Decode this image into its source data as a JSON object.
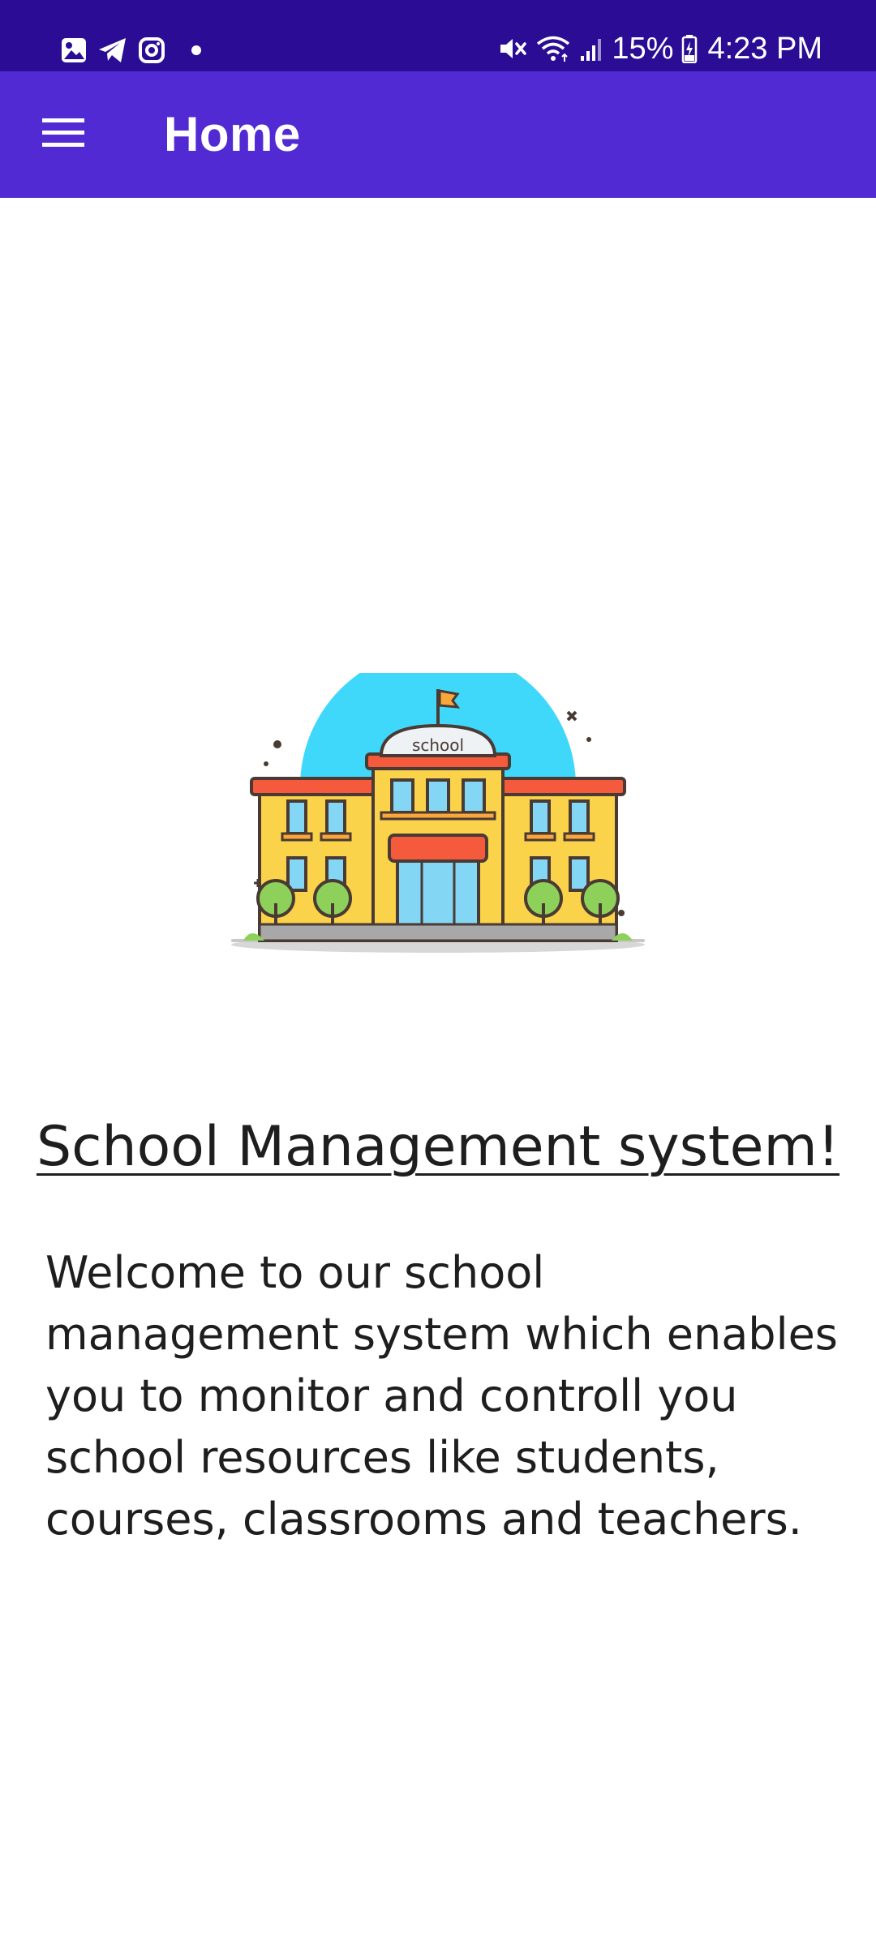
{
  "status_bar": {
    "left_icons": [
      "gallery-icon",
      "telegram-icon",
      "instagram-icon",
      "notification-dot-icon"
    ],
    "right_icons": [
      "mute-icon",
      "wifi-icon",
      "signal-icon",
      "battery-charging-icon"
    ],
    "battery": "15%",
    "time": "4:23 PM"
  },
  "app_bar": {
    "title": "Home",
    "menu_icon": "hamburger-menu-icon",
    "color": "#512ad4"
  },
  "main": {
    "illustration_label": "school",
    "headline": "School Management system!",
    "description": "Welcome to our school management system which enables you to monitor and controll you school resources like students, courses, classrooms and teachers."
  },
  "colors": {
    "status_bar": "#2a0d94",
    "app_bar": "#512ad4",
    "text": "#1e1e1e"
  }
}
